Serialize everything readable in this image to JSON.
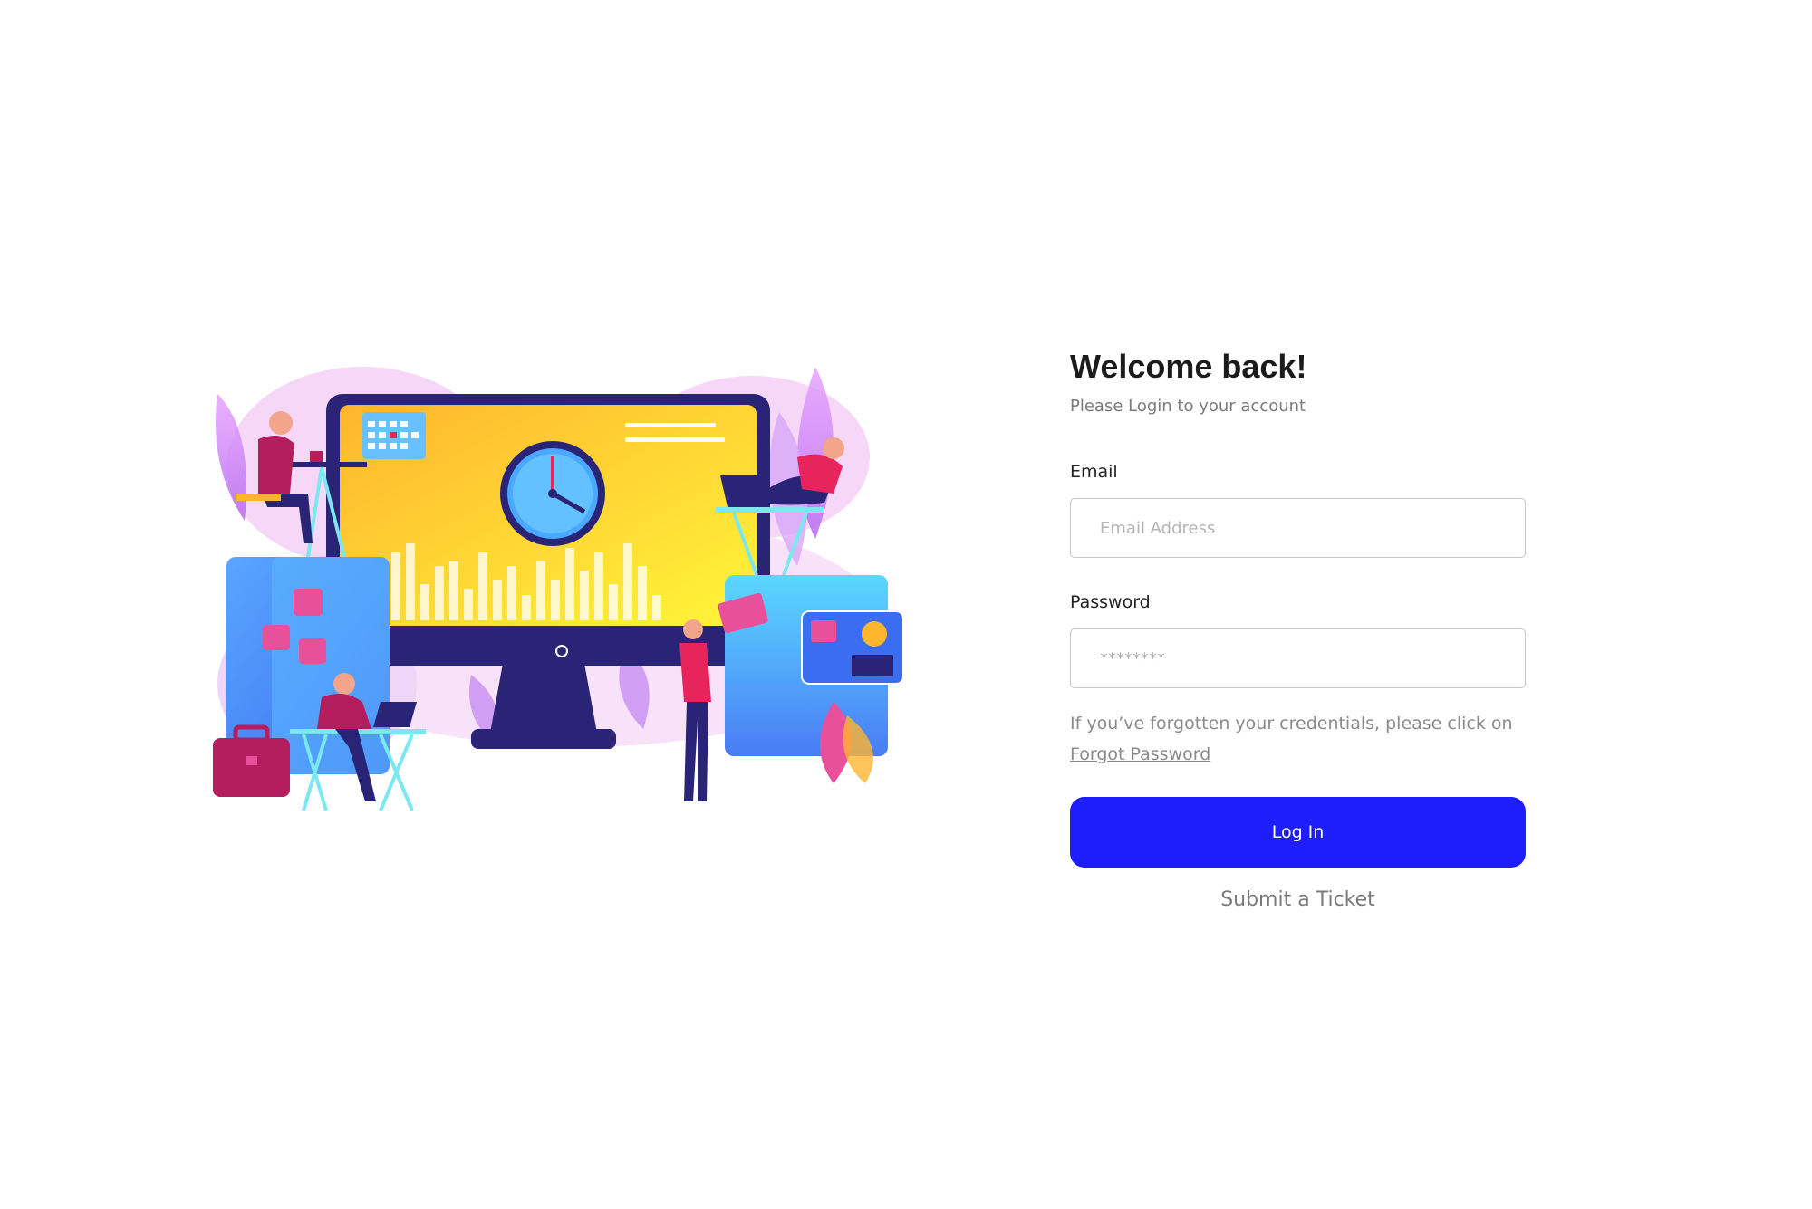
{
  "login": {
    "title": "Welcome back!",
    "subtitle": "Please Login to your account",
    "email_label": "Email",
    "email_placeholder": "Email Address",
    "password_label": "Password",
    "password_placeholder": "********",
    "hint_text": "If you’ve forgotten your credentials, please click on",
    "forgot_link": "Forgot Password",
    "login_button": "Log In",
    "ticket_link": "Submit a Ticket"
  },
  "colors": {
    "primary_button": "#1e1efc",
    "text_dark": "#1b1b1b",
    "text_muted": "#7a7a7a"
  },
  "illustration": {
    "name": "team-productivity-illustration"
  }
}
